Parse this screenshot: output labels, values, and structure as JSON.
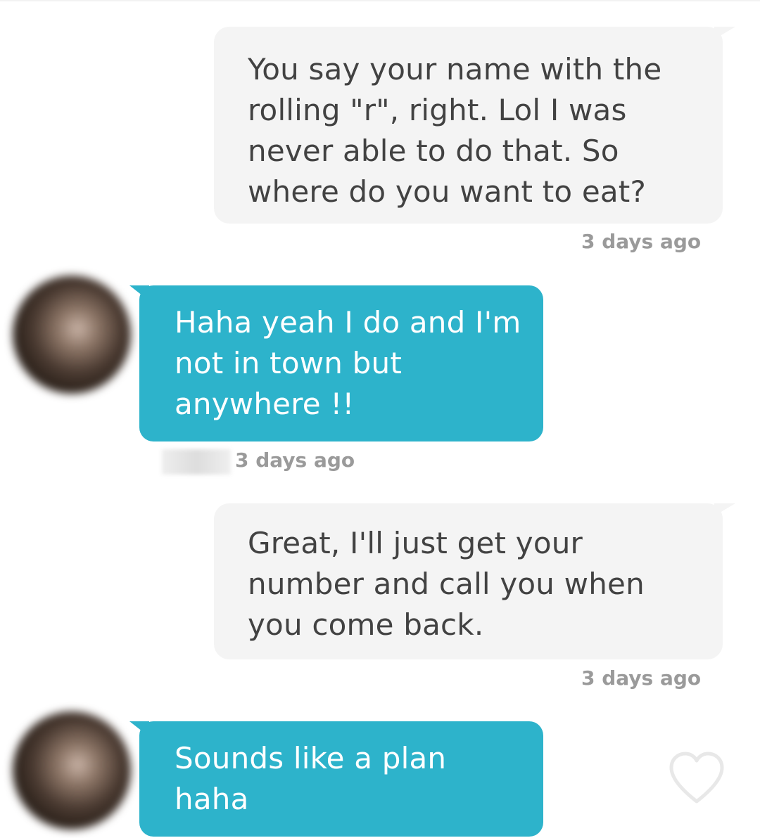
{
  "messages": [
    {
      "direction": "outgoing",
      "text": "You say your name with the rolling \"r\", right. Lol I was never able to do that. So where do you want to eat?",
      "timestamp": "3 days ago"
    },
    {
      "direction": "incoming",
      "text": "Haha yeah I do and I'm not in town but anywhere !!",
      "timestamp": "3 days ago"
    },
    {
      "direction": "outgoing",
      "text": "Great, I'll just get your number and call you when you come back.",
      "timestamp": "3 days ago"
    },
    {
      "direction": "incoming",
      "text": "Sounds like a plan haha"
    }
  ],
  "icons": {
    "like": "heart-outline-icon",
    "avatar": "avatar"
  },
  "colors": {
    "outgoing_bubble": "#f4f4f4",
    "incoming_bubble": "#2db3cb",
    "timestamp": "#9a9a9a",
    "heart_outline": "#e8e8e8"
  }
}
